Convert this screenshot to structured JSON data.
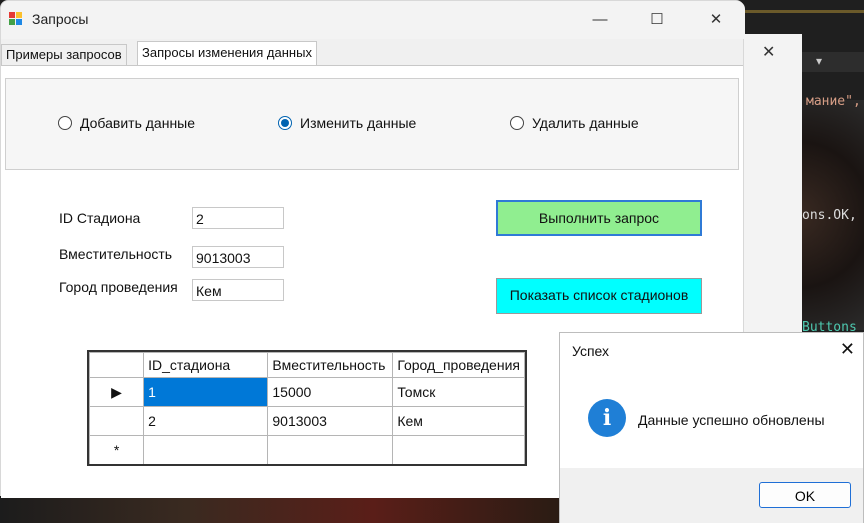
{
  "background": {
    "code_lines": [
      "мание\",",
      "ons.OK,",
      "Buttons"
    ],
    "dropdown_icon": "chevron-down-icon"
  },
  "window": {
    "title": "Запросы",
    "tabs": [
      {
        "label": "Примеры запросов",
        "active": false
      },
      {
        "label": "Запросы изменения данных",
        "active": true
      }
    ],
    "radios": [
      {
        "label": "Добавить данные",
        "checked": false
      },
      {
        "label": "Изменить данные",
        "checked": true
      },
      {
        "label": "Удалить данные",
        "checked": false
      }
    ],
    "fields": {
      "id_label": "ID Стадиона",
      "id_value": "2",
      "capacity_label": "Вместительность",
      "capacity_value": "9013003",
      "city_label": "Город проведения",
      "city_value": "Кем"
    },
    "buttons": {
      "run": "Выполнить запрос",
      "show_list": "Показать список стадионов"
    },
    "grid": {
      "columns": [
        "ID_стадиона",
        "Вместительность",
        "Город_проведения"
      ],
      "rows": [
        {
          "marker": "▶",
          "cells": [
            "1",
            "15000",
            "Томск"
          ]
        },
        {
          "marker": "",
          "cells": [
            "2",
            "9013003",
            "Кем"
          ]
        },
        {
          "marker": "*",
          "cells": [
            "",
            "",
            ""
          ]
        }
      ]
    }
  },
  "dialog": {
    "title": "Успех",
    "message": "Данные успешно обновлены",
    "ok_label": "OK",
    "icon": "info-icon"
  },
  "colors": {
    "run_button": "#90ee90",
    "list_button": "#00ffff",
    "selection": "#0078d7",
    "info_icon": "#1f7fd6"
  }
}
